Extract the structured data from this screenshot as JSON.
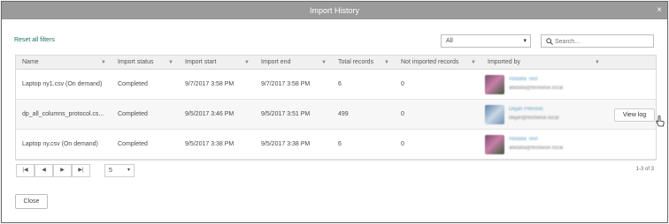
{
  "dialog": {
    "title": "Import History",
    "close_glyph": "×"
  },
  "toolbar": {
    "reset_label": "Reset all filters",
    "refresh_icon": "refresh-icon",
    "filter_value": "All",
    "search_placeholder": "Search..."
  },
  "columns": [
    "Name",
    "Import status",
    "Import start",
    "Import end",
    "Total records",
    "Not imported records",
    "Imported by"
  ],
  "rows": [
    {
      "name": "Laptop ny1.csv (On demand)",
      "status": "Completed",
      "start": "9/7/2017 3:58 PM",
      "end": "9/7/2017 3:58 PM",
      "total": "6",
      "not_imported": "0",
      "user_name": "Abdalla Test",
      "user_email": "abdalla@testwise.local"
    },
    {
      "name": "dp_all_columns_protocol.cs...",
      "status": "Completed",
      "start": "9/5/2017 3:46 PM",
      "end": "9/5/2017 3:51 PM",
      "total": "499",
      "not_imported": "0",
      "user_name": "Dejan Petrovic",
      "user_email": "dejan@testwise.local",
      "action": "View log"
    },
    {
      "name": "Laptop ny.csv (On demand)",
      "status": "Completed",
      "start": "9/5/2017 3:38 PM",
      "end": "9/5/2017 3:38 PM",
      "total": "6",
      "not_imported": "0",
      "user_name": "Abdalla Test",
      "user_email": "abdalla@testwise.local"
    }
  ],
  "pager": {
    "page_size": "5",
    "range": "1-3 of 3",
    "first": "|◀",
    "prev": "◀",
    "next": "▶",
    "last": "▶|"
  },
  "footer": {
    "close_label": "Close"
  },
  "colors": {
    "accent": "#1e6f61",
    "titlebar": "#9b9b9b",
    "link_blue": "#6aa2c4"
  }
}
